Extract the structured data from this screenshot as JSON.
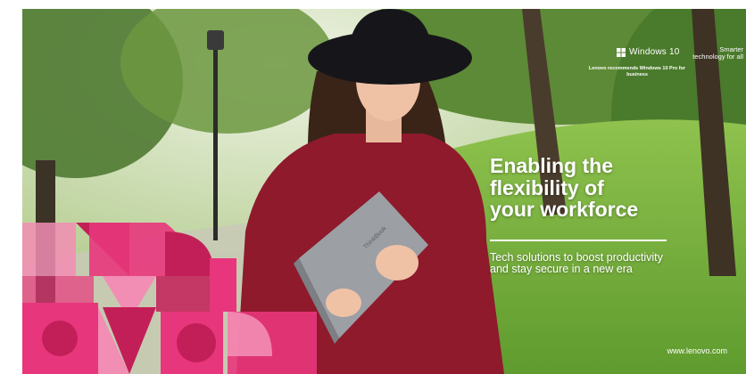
{
  "colors": {
    "sky": "#dfe9d3",
    "foliage_dark": "#4f7a32",
    "foliage_light": "#a9c96a",
    "grass": "#7fb843",
    "sweater": "#8e1a2c",
    "hat": "#16161a",
    "laptop": "#9c9fa4",
    "deco_pink": "#e8367c",
    "deco_magenta": "#c21f58",
    "deco_light_pink": "#f28db4",
    "text": "#ffffff"
  },
  "windows_badge": {
    "logo_icon": "windows-logo-icon",
    "label": "Windows 10",
    "recommendation": "Lenovo recommends Windows 10 Pro for business"
  },
  "tagline": "Smarter technology for all",
  "headline": "Enabling the\nflexibility of\nyour workforce",
  "subheadline": "Tech solutions to boost productivity and stay secure in a new era",
  "laptop_brand": "ThinkBook",
  "website": "www.lenovo.com"
}
